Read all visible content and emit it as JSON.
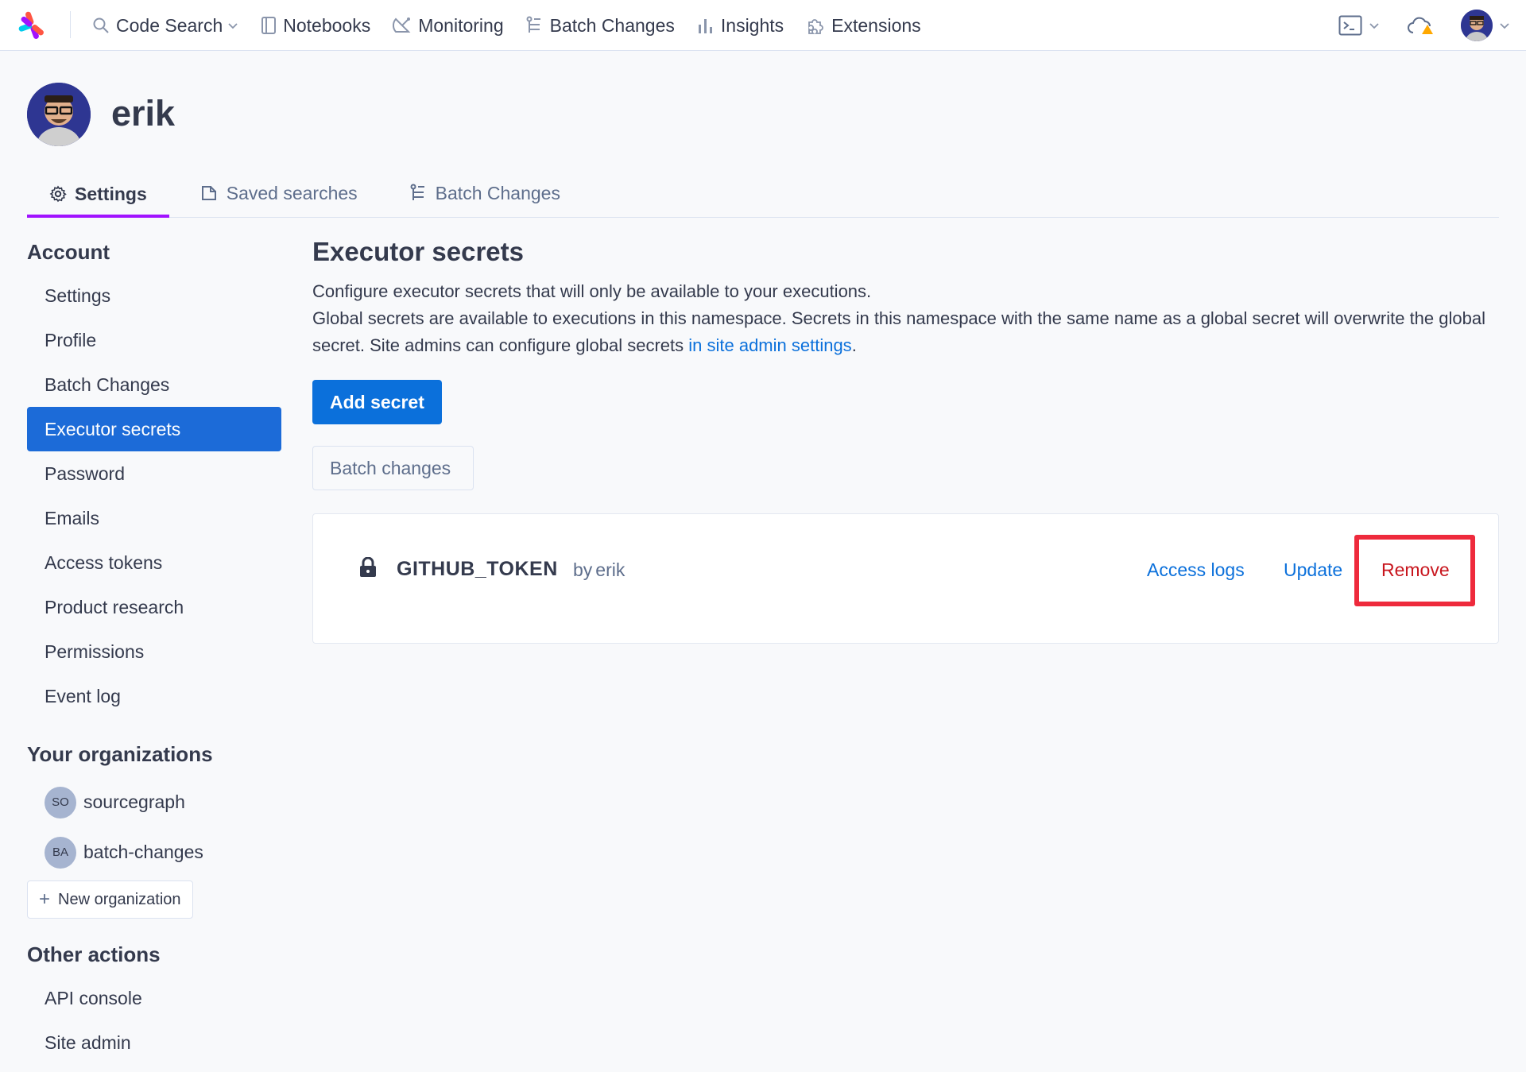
{
  "topnav": {
    "items": [
      {
        "label": "Code Search",
        "icon": "search-icon",
        "dropdown": true
      },
      {
        "label": "Notebooks",
        "icon": "notebook-icon"
      },
      {
        "label": "Monitoring",
        "icon": "satellite-icon"
      },
      {
        "label": "Batch Changes",
        "icon": "batch-changes-icon"
      },
      {
        "label": "Insights",
        "icon": "bar-chart-icon"
      },
      {
        "label": "Extensions",
        "icon": "puzzle-icon"
      }
    ],
    "right": [
      "terminal-icon",
      "cloud-warning-icon",
      "user-avatar"
    ]
  },
  "header": {
    "username": "erik"
  },
  "tabs": [
    {
      "label": "Settings",
      "icon": "gear-icon",
      "active": true
    },
    {
      "label": "Saved searches",
      "icon": "saved-search-icon"
    },
    {
      "label": "Batch Changes",
      "icon": "batch-changes-icon"
    }
  ],
  "sidebar": {
    "account_heading": "Account",
    "account_items": [
      {
        "label": "Settings"
      },
      {
        "label": "Profile"
      },
      {
        "label": "Batch Changes"
      },
      {
        "label": "Executor secrets",
        "active": true
      },
      {
        "label": "Password"
      },
      {
        "label": "Emails"
      },
      {
        "label": "Access tokens"
      },
      {
        "label": "Product research"
      },
      {
        "label": "Permissions"
      },
      {
        "label": "Event log"
      }
    ],
    "orgs_heading": "Your organizations",
    "orgs": [
      {
        "badge": "SO",
        "label": "sourcegraph"
      },
      {
        "badge": "BA",
        "label": "batch-changes"
      }
    ],
    "new_org_label": "New organization",
    "other_heading": "Other actions",
    "other_items": [
      {
        "label": "API console"
      },
      {
        "label": "Site admin"
      }
    ]
  },
  "main": {
    "title": "Executor secrets",
    "desc_line1": "Configure executor secrets that will only be available to your executions.",
    "desc_line2": "Global secrets are available to executions in this namespace. Secrets in this namespace with the same name as a global secret will overwrite the global secret. Site admins can configure global secrets ",
    "desc_link": "in site admin settings",
    "desc_end": ".",
    "add_secret_label": "Add secret",
    "scope_label": "Batch changes",
    "secret": {
      "name": "GITHUB_TOKEN",
      "by_label": "by",
      "owner": "erik",
      "access_logs_label": "Access logs",
      "update_label": "Update",
      "remove_label": "Remove"
    }
  },
  "colors": {
    "primary": "#0b70db",
    "active_tab_underline": "#a112ff",
    "danger": "#c8161e",
    "highlight_box": "#ee2a3c",
    "sidebar_active": "#1c6bd8"
  }
}
